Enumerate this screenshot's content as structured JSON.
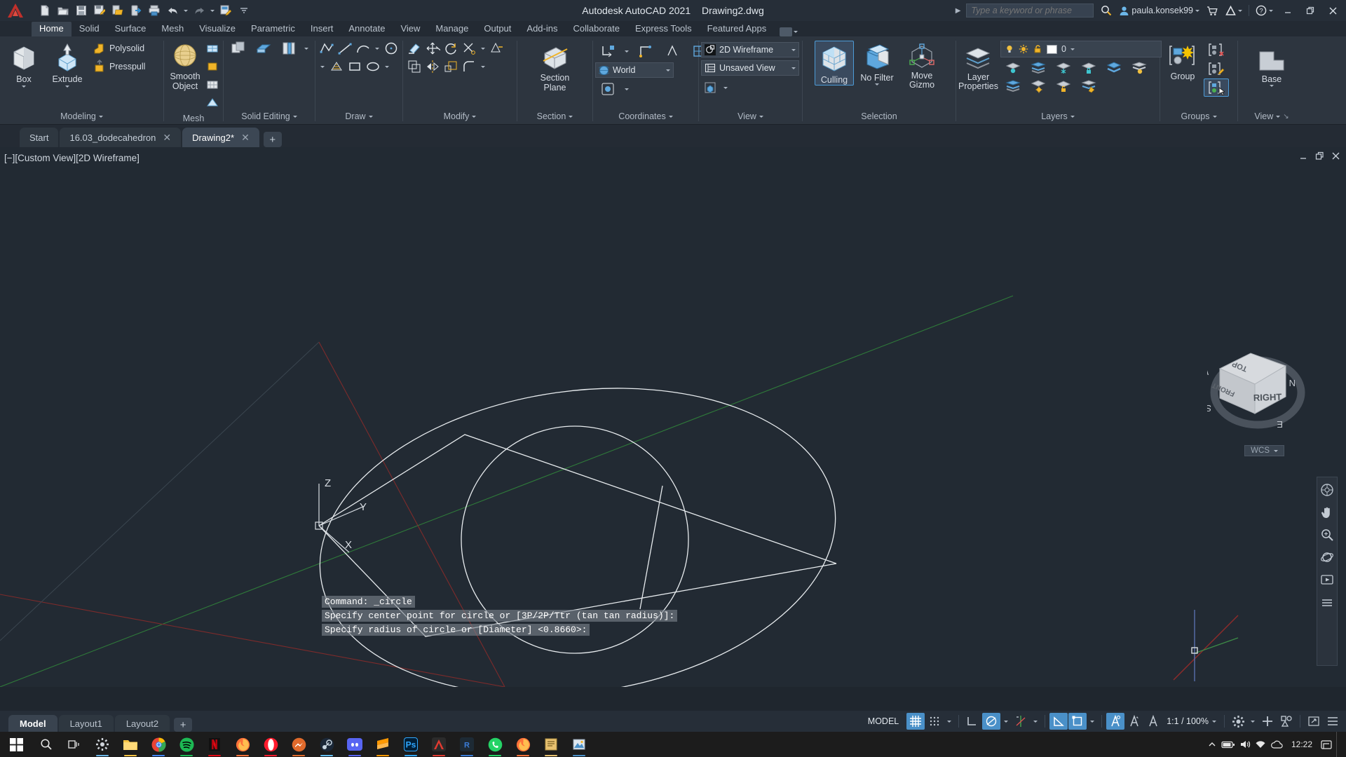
{
  "titlebar": {
    "app_title": "Autodesk AutoCAD 2021",
    "document_title": "Drawing2.dwg",
    "quick_access": [
      {
        "name": "new-drawing",
        "label": "New"
      },
      {
        "name": "open-drawing",
        "label": "Open"
      },
      {
        "name": "save-drawing",
        "label": "Save"
      },
      {
        "name": "save-as",
        "label": "Save As"
      },
      {
        "name": "open-from-web",
        "label": "Open from Web & Mobile"
      },
      {
        "name": "save-to-web",
        "label": "Save to Web & Mobile"
      },
      {
        "name": "plot",
        "label": "Plot"
      },
      {
        "name": "undo",
        "label": "Undo"
      },
      {
        "name": "redo",
        "label": "Redo"
      },
      {
        "name": "batch-plot",
        "label": "Batch Plot"
      }
    ],
    "search_placeholder": "Type a keyword or phrase",
    "account_name": "paula.konsek99",
    "help_label": "?",
    "window_buttons": {
      "minimize": "–",
      "restore": "❐",
      "close": "✕"
    }
  },
  "ribbon_tabs": [
    {
      "label": "Home",
      "active": true
    },
    {
      "label": "Solid",
      "active": false
    },
    {
      "label": "Surface",
      "active": false
    },
    {
      "label": "Mesh",
      "active": false
    },
    {
      "label": "Visualize",
      "active": false
    },
    {
      "label": "Parametric",
      "active": false
    },
    {
      "label": "Insert",
      "active": false
    },
    {
      "label": "Annotate",
      "active": false
    },
    {
      "label": "View",
      "active": false
    },
    {
      "label": "Manage",
      "active": false
    },
    {
      "label": "Output",
      "active": false
    },
    {
      "label": "Add-ins",
      "active": false
    },
    {
      "label": "Collaborate",
      "active": false
    },
    {
      "label": "Express Tools",
      "active": false
    },
    {
      "label": "Featured Apps",
      "active": false
    }
  ],
  "ribbon_panels": {
    "modeling": {
      "label": "Modeling",
      "big_buttons": [
        {
          "name": "box-tool",
          "label": "Box"
        },
        {
          "name": "extrude-tool",
          "label": "Extrude"
        }
      ],
      "small_buttons": [
        {
          "name": "polysolid-tool",
          "label": "Polysolid"
        },
        {
          "name": "presspull-tool",
          "label": "Presspull"
        }
      ]
    },
    "mesh": {
      "label": "Mesh",
      "big_buttons": [
        {
          "name": "smooth-object-tool",
          "label": "Smooth Object"
        }
      ]
    },
    "solid_editing": {
      "label": "Solid Editing"
    },
    "draw": {
      "label": "Draw"
    },
    "modify": {
      "label": "Modify"
    },
    "section": {
      "label": "Section",
      "big_buttons": [
        {
          "name": "section-plane-tool",
          "label": "Section Plane"
        }
      ]
    },
    "coordinates": {
      "label": "Coordinates",
      "ucs_dropdown": "World"
    },
    "view": {
      "label": "View",
      "visual_style": "2D Wireframe",
      "named_view": "Unsaved View"
    },
    "selection": {
      "label": "Selection",
      "buttons": [
        {
          "name": "culling-toggle",
          "label": "Culling",
          "active": true
        },
        {
          "name": "filter-dropdown",
          "label": "No Filter",
          "active": false
        },
        {
          "name": "move-gizmo",
          "label": "Move Gizmo",
          "active": false
        }
      ]
    },
    "layers": {
      "label": "Layers",
      "layer_properties_label": "Layer Properties",
      "current_layer": "0"
    },
    "groups": {
      "label": "Groups",
      "group_label": "Group"
    },
    "view_panel_right": {
      "label": "View",
      "base_label": "Base"
    }
  },
  "file_tabs": [
    {
      "label": "Start",
      "closable": false,
      "active": false
    },
    {
      "label": "16.03_dodecahedron",
      "closable": true,
      "active": false
    },
    {
      "label": "Drawing2*",
      "closable": true,
      "active": true
    }
  ],
  "viewport": {
    "label": "[−][Custom View][2D Wireframe]",
    "viewcube_faces": {
      "top": "TOP",
      "front": "FRONT",
      "right": "RIGHT"
    },
    "compass": {
      "north": "N",
      "south": "S",
      "east": "E",
      "west": "W"
    },
    "wcs_label": "WCS",
    "ucs_axes": {
      "x": "X",
      "y": "Y",
      "z": "Z"
    }
  },
  "command_line": {
    "history": [
      "Command: _circle",
      "Specify center point for circle or [3P/2P/Ttr (tan tan radius)]:",
      "Specify radius of circle or [Diameter] <0.8660>:"
    ],
    "input_value": "",
    "prompt_glyph": "⌨"
  },
  "layout_tabs": [
    {
      "label": "Model",
      "active": true
    },
    {
      "label": "Layout1",
      "active": false
    },
    {
      "label": "Layout2",
      "active": false
    }
  ],
  "status_bar": {
    "space_label": "MODEL",
    "scale_label": "1:1 / 100%",
    "toggles": [
      {
        "name": "grid-display",
        "label": "Grid Display",
        "on": true
      },
      {
        "name": "snap-mode",
        "label": "Snap Mode",
        "on": false
      },
      {
        "name": "ortho-mode",
        "label": "Ortho Mode",
        "on": false
      },
      {
        "name": "polar-tracking",
        "label": "Polar Tracking",
        "on": true
      },
      {
        "name": "object-snap-tracking",
        "label": "Object Snap Tracking",
        "on": false
      },
      {
        "name": "object-snap",
        "label": "Object Snap",
        "on": true
      },
      {
        "name": "dynamic-ucs",
        "label": "Allow/Disallow Dynamic UCS",
        "on": true
      },
      {
        "name": "dynamic-input",
        "label": "Dynamic Input",
        "on": true
      },
      {
        "name": "selection-cycling",
        "label": "Selection Cycling",
        "on": true
      },
      {
        "name": "annotation-visibility",
        "label": "Annotation Visibility",
        "on": false
      },
      {
        "name": "autoscale",
        "label": "AutoScale",
        "on": false
      }
    ]
  },
  "taskbar": {
    "clock_time": "12:22",
    "apps": [
      {
        "name": "file-explorer",
        "color": "#f5c242",
        "running": true
      },
      {
        "name": "chrome",
        "color": "#4285f4",
        "running": true
      },
      {
        "name": "spotify",
        "color": "#1db954",
        "running": true
      },
      {
        "name": "netflix",
        "color": "#e50914",
        "running": true
      },
      {
        "name": "firefox",
        "color": "#ff7139",
        "running": true
      },
      {
        "name": "opera",
        "color": "#ff1b2d",
        "running": true
      },
      {
        "name": "messenger",
        "color": "#e06a2b",
        "running": true
      },
      {
        "name": "steam",
        "color": "#2a475e",
        "running": true
      },
      {
        "name": "discord",
        "color": "#5865f2",
        "running": true
      },
      {
        "name": "sublime",
        "color": "#ff9800",
        "running": true
      },
      {
        "name": "photoshop",
        "color": "#31a8ff",
        "running": true
      },
      {
        "name": "autocad",
        "color": "#c0392b",
        "running": true
      },
      {
        "name": "revit",
        "color": "#3b7dd8",
        "running": true
      },
      {
        "name": "whatsapp",
        "color": "#25d366",
        "running": true
      },
      {
        "name": "firefox-dev",
        "color": "#ff7139",
        "running": true
      },
      {
        "name": "notes",
        "color": "#e8c170",
        "running": true
      },
      {
        "name": "image-viewer",
        "color": "#4a90c8",
        "running": true
      }
    ]
  },
  "colors": {
    "accent": "#4a90c8",
    "titlebar_bg": "#262e38",
    "ribbon_bg": "#2d353f",
    "canvas_bg": "#222a33",
    "geometry_stroke": "#ffffff",
    "axis_x": "#8f2b2b",
    "axis_y": "#2f7a3a",
    "taskbar_bg": "#1c1c1c"
  }
}
